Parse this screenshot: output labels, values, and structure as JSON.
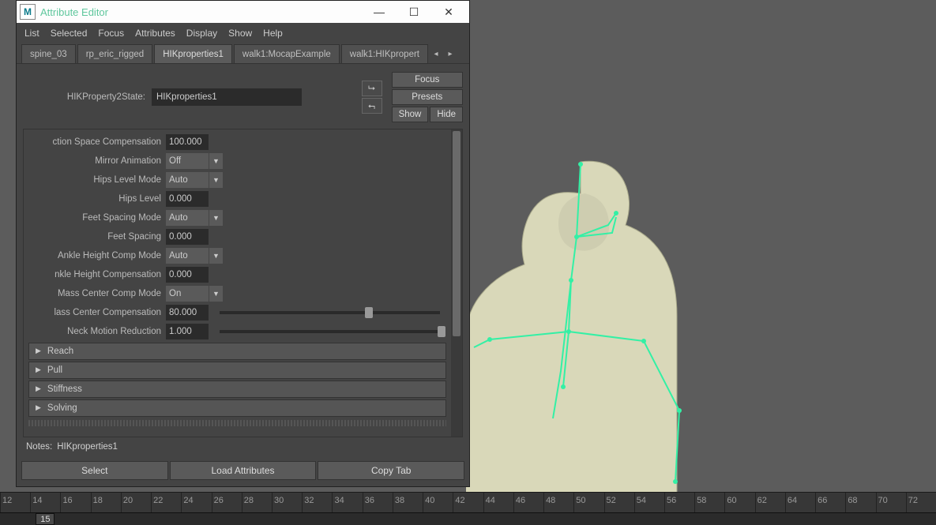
{
  "window": {
    "title": "Attribute Editor"
  },
  "menubar": [
    "List",
    "Selected",
    "Focus",
    "Attributes",
    "Display",
    "Show",
    "Help"
  ],
  "tabs": [
    {
      "label": "spine_03",
      "active": false
    },
    {
      "label": "rp_eric_rigged",
      "active": false
    },
    {
      "label": "HIKproperties1",
      "active": true
    },
    {
      "label": "walk1:MocapExample",
      "active": false
    },
    {
      "label": "walk1:HIKpropert",
      "active": false
    }
  ],
  "node": {
    "type_label": "HIKProperty2State:",
    "name": "HIKproperties1"
  },
  "top_buttons": {
    "focus": "Focus",
    "presets": "Presets",
    "show": "Show",
    "hide": "Hide"
  },
  "fields": [
    {
      "label": "ction Space Compensation",
      "kind": "num",
      "value": "100.000"
    },
    {
      "label": "Mirror Animation",
      "kind": "dd",
      "value": "Off"
    },
    {
      "label": "Hips Level Mode",
      "kind": "dd",
      "value": "Auto"
    },
    {
      "label": "Hips Level",
      "kind": "num",
      "value": "0.000"
    },
    {
      "label": "Feet Spacing Mode",
      "kind": "dd",
      "value": "Auto"
    },
    {
      "label": "Feet Spacing",
      "kind": "num",
      "value": "0.000"
    },
    {
      "label": "Ankle Height Comp Mode",
      "kind": "dd",
      "value": "Auto"
    },
    {
      "label": "nkle Height Compensation",
      "kind": "num",
      "value": "0.000"
    },
    {
      "label": "Mass Center Comp Mode",
      "kind": "dd",
      "value": "On"
    },
    {
      "label": "lass Center Compensation",
      "kind": "numslider",
      "value": "80.000",
      "slider_pos": 0.66
    },
    {
      "label": "Neck Motion Reduction",
      "kind": "numslider",
      "value": "1.000",
      "slider_pos": 0.99
    }
  ],
  "sections": [
    "Reach",
    "Pull",
    "Stiffness",
    "Solving"
  ],
  "notes": {
    "label": "Notes:",
    "value": "HIKproperties1"
  },
  "bottom_buttons": [
    "Select",
    "Load Attributes",
    "Copy Tab"
  ],
  "timeline": {
    "start": 12,
    "end": 74,
    "step": 2,
    "current": 15
  }
}
